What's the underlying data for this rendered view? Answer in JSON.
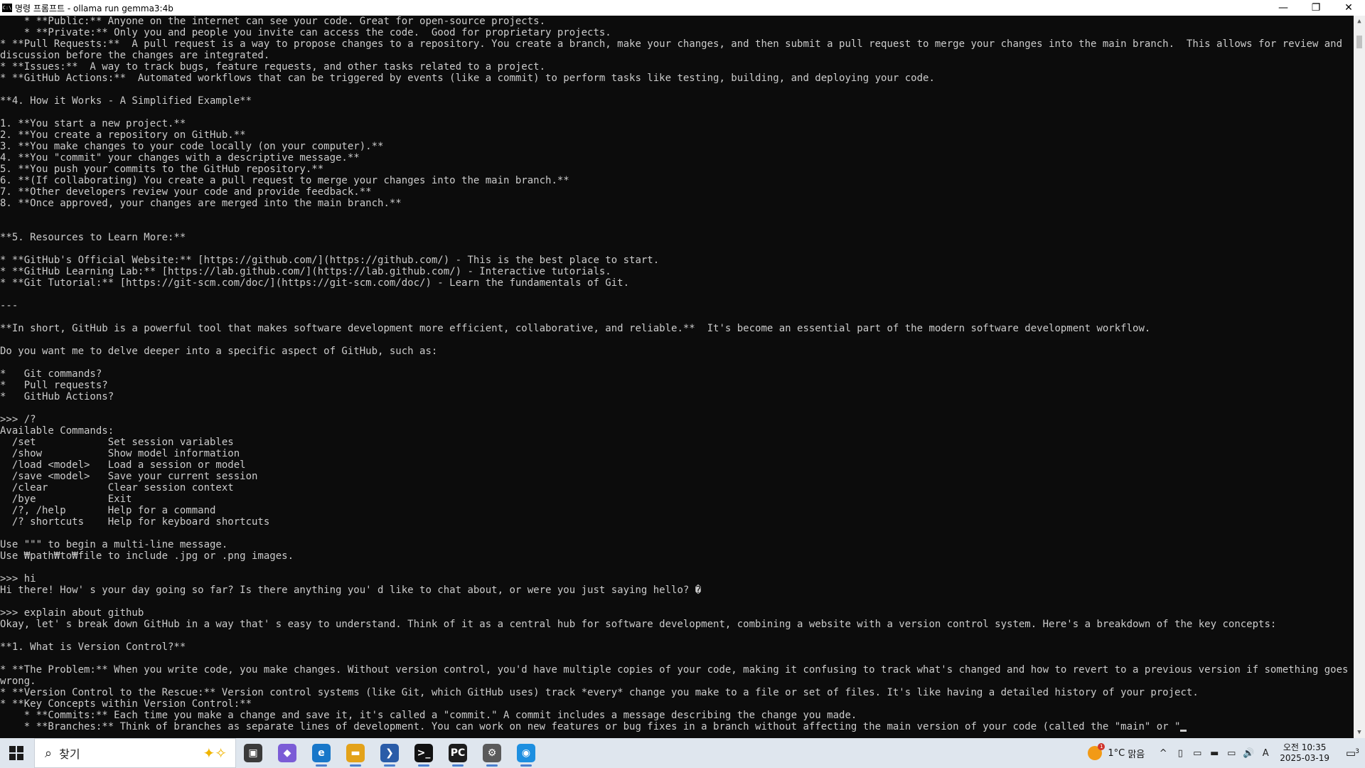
{
  "window": {
    "title": "명령 프롬프트 - ollama  run gemma3:4b",
    "icon_text": "C:\\",
    "controls": [
      "—",
      "❐",
      "✕"
    ]
  },
  "console": {
    "lines": [
      "    * **Public:** Anyone on the internet can see your code. Great for open-source projects.",
      "    * **Private:** Only you and people you invite can access the code.  Good for proprietary projects.",
      "* **Pull Requests:**  A pull request is a way to propose changes to a repository. You create a branch, make your changes, and then submit a pull request to merge your changes into the main branch.  This allows for review and",
      "discussion before the changes are integrated.",
      "* **Issues:**  A way to track bugs, feature requests, and other tasks related to a project.",
      "* **GitHub Actions:**  Automated workflows that can be triggered by events (like a commit) to perform tasks like testing, building, and deploying your code.",
      "",
      "**4. How it Works - A Simplified Example**",
      "",
      "1. **You start a new project.**",
      "2. **You create a repository on GitHub.**",
      "3. **You make changes to your code locally (on your computer).**",
      "4. **You \"commit\" your changes with a descriptive message.**",
      "5. **You push your commits to the GitHub repository.**",
      "6. **(If collaborating) You create a pull request to merge your changes into the main branch.**",
      "7. **Other developers review your code and provide feedback.**",
      "8. **Once approved, your changes are merged into the main branch.**",
      "",
      "",
      "**5. Resources to Learn More:**",
      "",
      "* **GitHub's Official Website:** [https://github.com/](https://github.com/) - This is the best place to start.",
      "* **GitHub Learning Lab:** [https://lab.github.com/](https://lab.github.com/) - Interactive tutorials.",
      "* **Git Tutorial:** [https://git-scm.com/doc/](https://git-scm.com/doc/) - Learn the fundamentals of Git.",
      "",
      "---",
      "",
      "**In short, GitHub is a powerful tool that makes software development more efficient, collaborative, and reliable.**  It's become an essential part of the modern software development workflow.",
      "",
      "Do you want me to delve deeper into a specific aspect of GitHub, such as:",
      "",
      "*   Git commands?",
      "*   Pull requests?",
      "*   GitHub Actions?",
      "",
      ">>> /?",
      "Available Commands:",
      "  /set            Set session variables",
      "  /show           Show model information",
      "  /load <model>   Load a session or model",
      "  /save <model>   Save your current session",
      "  /clear          Clear session context",
      "  /bye            Exit",
      "  /?, /help       Help for a command",
      "  /? shortcuts    Help for keyboard shortcuts",
      "",
      "Use \"\"\" to begin a multi-line message.",
      "Use ₩path₩to₩file to include .jpg or .png images.",
      "",
      ">>> hi",
      "Hi there! How' s your day going so far? Is there anything you' d like to chat about, or were you just saying hello? �",
      "",
      ">>> explain about github",
      "Okay, let' s break down GitHub in a way that' s easy to understand. Think of it as a central hub for software development, combining a website with a version control system. Here's a breakdown of the key concepts:",
      "",
      "**1. What is Version Control?**",
      "",
      "* **The Problem:** When you write code, you make changes. Without version control, you'd have multiple copies of your code, making it confusing to track what's changed and how to revert to a previous version if something goes",
      "wrong.",
      "* **Version Control to the Rescue:** Version control systems (like Git, which GitHub uses) track *every* change you make to a file or set of files. It's like having a detailed history of your project.",
      "* **Key Concepts within Version Control:**",
      "    * **Commits:** Each time you make a change and save it, it's called a \"commit.\" A commit includes a message describing the change you made.",
      "    * **Branches:** Think of branches as separate lines of development. You can work on new features or bug fixes in a branch without affecting the main version of your code (called the \"main\" or \""
    ]
  },
  "taskbar": {
    "search_placeholder": "찾기",
    "apps": [
      {
        "name": "task-view",
        "glyph": "▣",
        "color": "#3a3a3a"
      },
      {
        "name": "copilot",
        "glyph": "◆",
        "color": "#7b5cd6"
      },
      {
        "name": "edge",
        "glyph": "e",
        "color": "#1877c9"
      },
      {
        "name": "file-explorer",
        "glyph": "▬",
        "color": "#e3a21a"
      },
      {
        "name": "powershell",
        "glyph": "❯",
        "color": "#2a5ca8"
      },
      {
        "name": "terminal",
        "glyph": ">_",
        "color": "#111111"
      },
      {
        "name": "pycharm",
        "glyph": "PC",
        "color": "#1c1c1c"
      },
      {
        "name": "settings",
        "glyph": "⚙",
        "color": "#5a5a5a"
      },
      {
        "name": "docker",
        "glyph": "◉",
        "color": "#1d8fe0"
      }
    ],
    "weather": {
      "temp": "1°C",
      "condition": "맑음",
      "badge": "1"
    },
    "tray_icons": [
      "^",
      "▯",
      "▭",
      "▬",
      "▭",
      "🔊",
      "A"
    ],
    "clock": {
      "time": "오전 10:35",
      "date": "2025-03-19"
    },
    "notification_count": "3"
  }
}
